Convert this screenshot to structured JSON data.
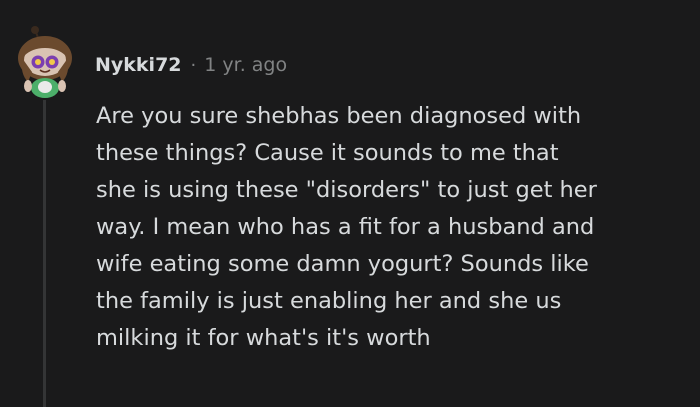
{
  "comment": {
    "author": "Nykki72",
    "separator": "·",
    "timestamp": "1 yr. ago",
    "avatar_icon": "snoo-avatar-icon",
    "colors": {
      "background": "#1a1a1b",
      "text": "#d7dadc",
      "meta": "#818384",
      "thread_line": "#343536"
    },
    "body_lines": [
      "Are you sure shebhas been diagnosed with",
      "these things? Cause it sounds to me that",
      "she is using these \"disorders\" to just get her",
      "way. I mean who has a fit for a husband and",
      "wife eating some damn yogurt? Sounds like",
      "the family is just enabling her and she us",
      "milking it for what's it's worth"
    ]
  }
}
